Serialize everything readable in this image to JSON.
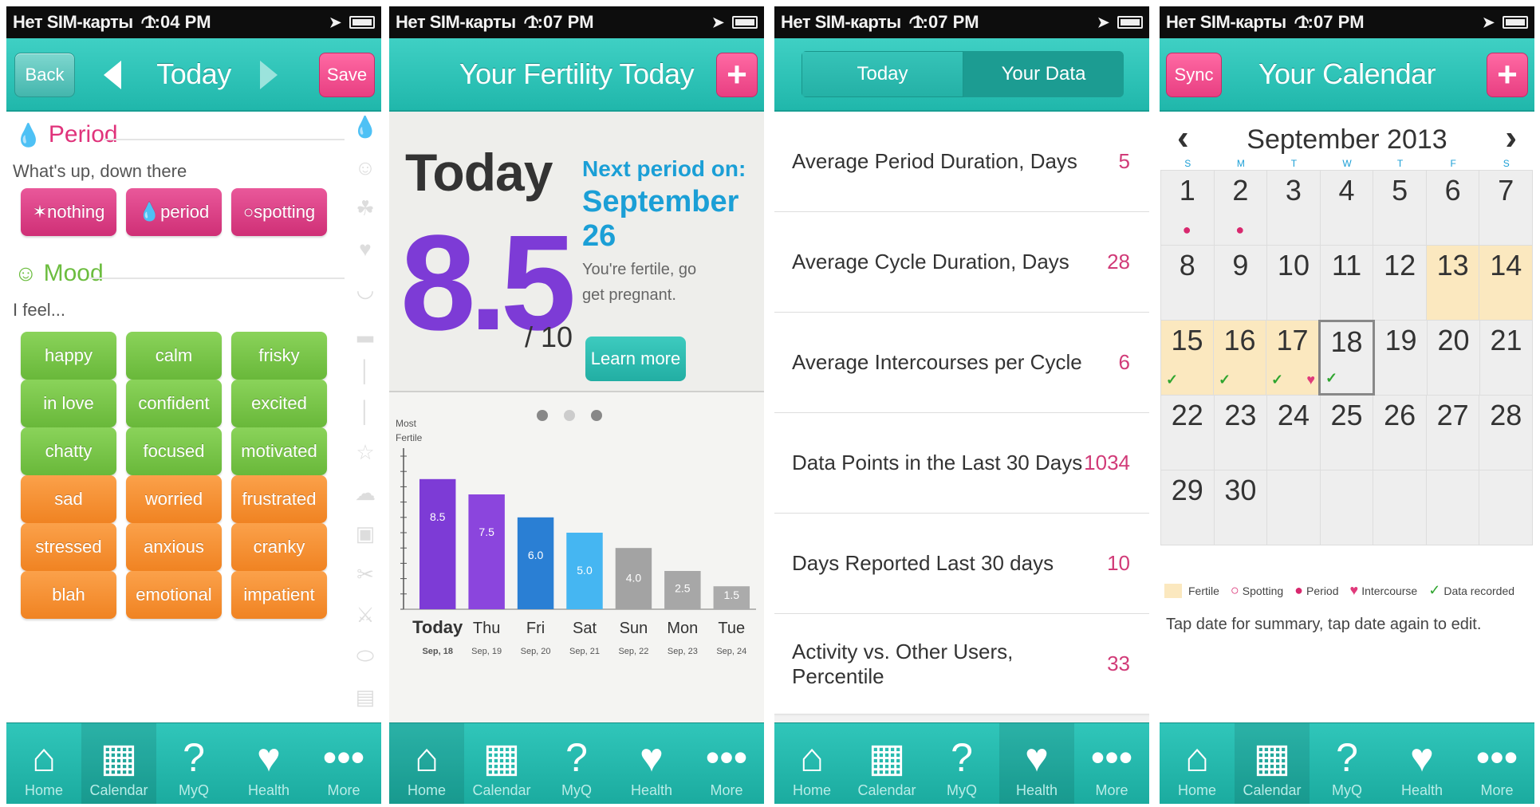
{
  "status": {
    "carrier": "Нет SIM-карты",
    "times": [
      "1:04 PM",
      "1:07 PM",
      "1:07 PM",
      "1:07 PM"
    ]
  },
  "tabbar": {
    "items": [
      {
        "label": "Home",
        "icon": "home-icon"
      },
      {
        "label": "Calendar",
        "icon": "calendar-icon"
      },
      {
        "label": "MyQ",
        "icon": "question-person-icon"
      },
      {
        "label": "Health",
        "icon": "heart-pulse-icon"
      },
      {
        "label": "More",
        "icon": "more-dots-icon"
      }
    ]
  },
  "screen1": {
    "back_label": "Back",
    "title": "Today",
    "save_label": "Save",
    "period": {
      "title": "Period",
      "subtitle": "What's up, down there",
      "options": [
        "nothing",
        "period",
        "spotting"
      ]
    },
    "mood": {
      "title": "Mood",
      "subtitle": "I feel...",
      "options": [
        [
          "happy",
          "calm",
          "frisky"
        ],
        [
          "in love",
          "confident",
          "excited"
        ],
        [
          "chatty",
          "focused",
          "motivated"
        ],
        [
          "sad",
          "worried",
          "frustrated"
        ],
        [
          "stressed",
          "anxious",
          "cranky"
        ],
        [
          "blah",
          "emotional",
          "impatient"
        ]
      ]
    }
  },
  "screen2": {
    "title": "Your Fertility Today",
    "today_label": "Today",
    "score": "8.5",
    "score_max": "/ 10",
    "next_period_label": "Next period on:",
    "next_period_date": "September 26",
    "fertile_text": "You're fertile, go get pregnant.",
    "learn_more": "Learn more",
    "y_axis_label": "Most Fertile",
    "chart_data": {
      "type": "bar",
      "categories": [
        "Today",
        "Thu",
        "Fri",
        "Sat",
        "Sun",
        "Mon",
        "Tue"
      ],
      "dates": [
        "Sep, 18",
        "Sep, 19",
        "Sep, 20",
        "Sep, 21",
        "Sep, 22",
        "Sep, 23",
        "Sep, 24"
      ],
      "values": [
        8.5,
        7.5,
        6.0,
        5.0,
        4.0,
        2.5,
        1.5
      ],
      "value_labels": [
        "8.5",
        "7.5",
        "6.0",
        "5.0",
        "4.0",
        "2.5",
        "1.5"
      ],
      "colors": [
        "#7d3bd6",
        "#8b45dd",
        "#2a7fd4",
        "#45b6f2",
        "#a3a3a3",
        "#a7a7a7",
        "#ababab"
      ],
      "ylim": [
        0,
        10
      ]
    }
  },
  "screen3": {
    "seg_today": "Today",
    "seg_data": "Your Data",
    "rows": [
      {
        "label": "Average Period Duration, Days",
        "value": "5"
      },
      {
        "label": "Average Cycle Duration, Days",
        "value": "28"
      },
      {
        "label": "Average Intercourses per Cycle",
        "value": "6"
      },
      {
        "label": "Data Points in the Last 30 Days",
        "value": "1034"
      },
      {
        "label": "Days Reported Last 30 days",
        "value": "10"
      },
      {
        "label": "Activity vs. Other Users, Percentile",
        "value": "33"
      }
    ]
  },
  "screen4": {
    "sync_label": "Sync",
    "title": "Your Calendar",
    "month": "September 2013",
    "weekdays": [
      "S",
      "M",
      "T",
      "W",
      "T",
      "F",
      "S"
    ],
    "weeks": [
      [
        "1",
        "2",
        "3",
        "4",
        "5",
        "6",
        "7"
      ],
      [
        "8",
        "9",
        "10",
        "11",
        "12",
        "13",
        "14"
      ],
      [
        "15",
        "16",
        "17",
        "18",
        "19",
        "20",
        "21"
      ],
      [
        "22",
        "23",
        "24",
        "25",
        "26",
        "27",
        "28"
      ],
      [
        "29",
        "30",
        "",
        "",
        "",
        "",
        ""
      ]
    ],
    "legend": {
      "fertile": "Fertile",
      "spotting": "Spotting",
      "period": "Period",
      "intercourse": "Intercourse",
      "recorded": "Data recorded"
    },
    "hint": "Tap date for summary, tap date again to edit."
  }
}
